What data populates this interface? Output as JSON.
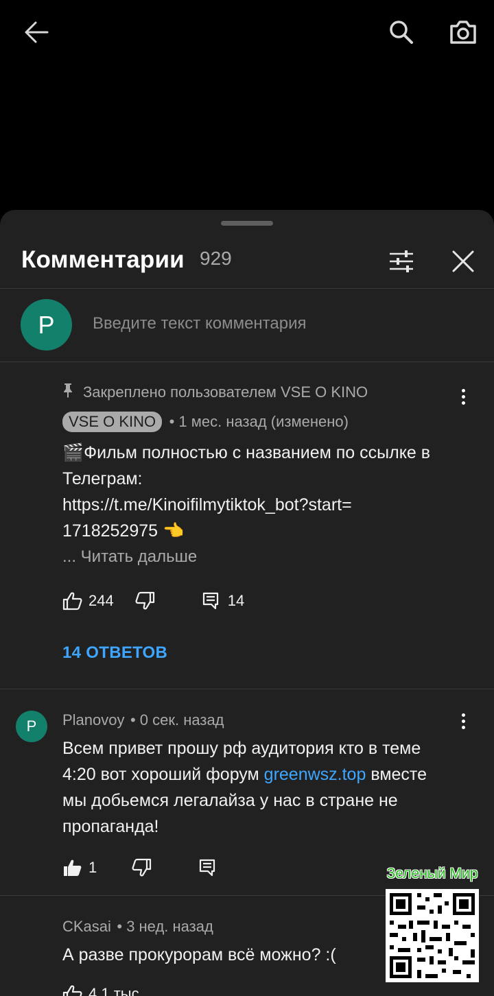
{
  "sheet": {
    "title": "Комментарии",
    "count": "929"
  },
  "compose": {
    "avatar_letter": "P",
    "placeholder": "Введите текст комментария"
  },
  "pinned_comment": {
    "pinned_label": "Закреплено пользователем VSE O KINO",
    "author": "VSE O KINO",
    "time": "• 1 мес. назад (изменено)",
    "line1": "🎬Фильм полностью с названием по ссылке в",
    "line2": "Телеграм:",
    "line3": "https://t.me/Kinoifilmytiktok_bot?start=",
    "line4": "1718252975 👈",
    "read_more": "... Читать дальше",
    "likes": "244",
    "reply_count": "14",
    "replies_link": "14 ОТВЕТОВ"
  },
  "comment2": {
    "avatar_letter": "P",
    "author": "Planovoy",
    "time": "• 0 сек. назад",
    "line1": "Всем привет прошу рф аудитория кто в теме",
    "line2_start": "4:20 вот хороший форум ",
    "line2_link": "greenwsz.top",
    "line2_end": " вместе",
    "line3": "мы добьемся легалайза у нас в стране не",
    "line4": "пропаганда!",
    "likes": "1"
  },
  "comment3": {
    "author": "CKasai",
    "time": "• 3 нед. назад",
    "line1": "А разве прокурорам всё можно? :(",
    "likes": "4,1 тыс."
  },
  "watermark": {
    "label": "Зеленый Мир"
  }
}
